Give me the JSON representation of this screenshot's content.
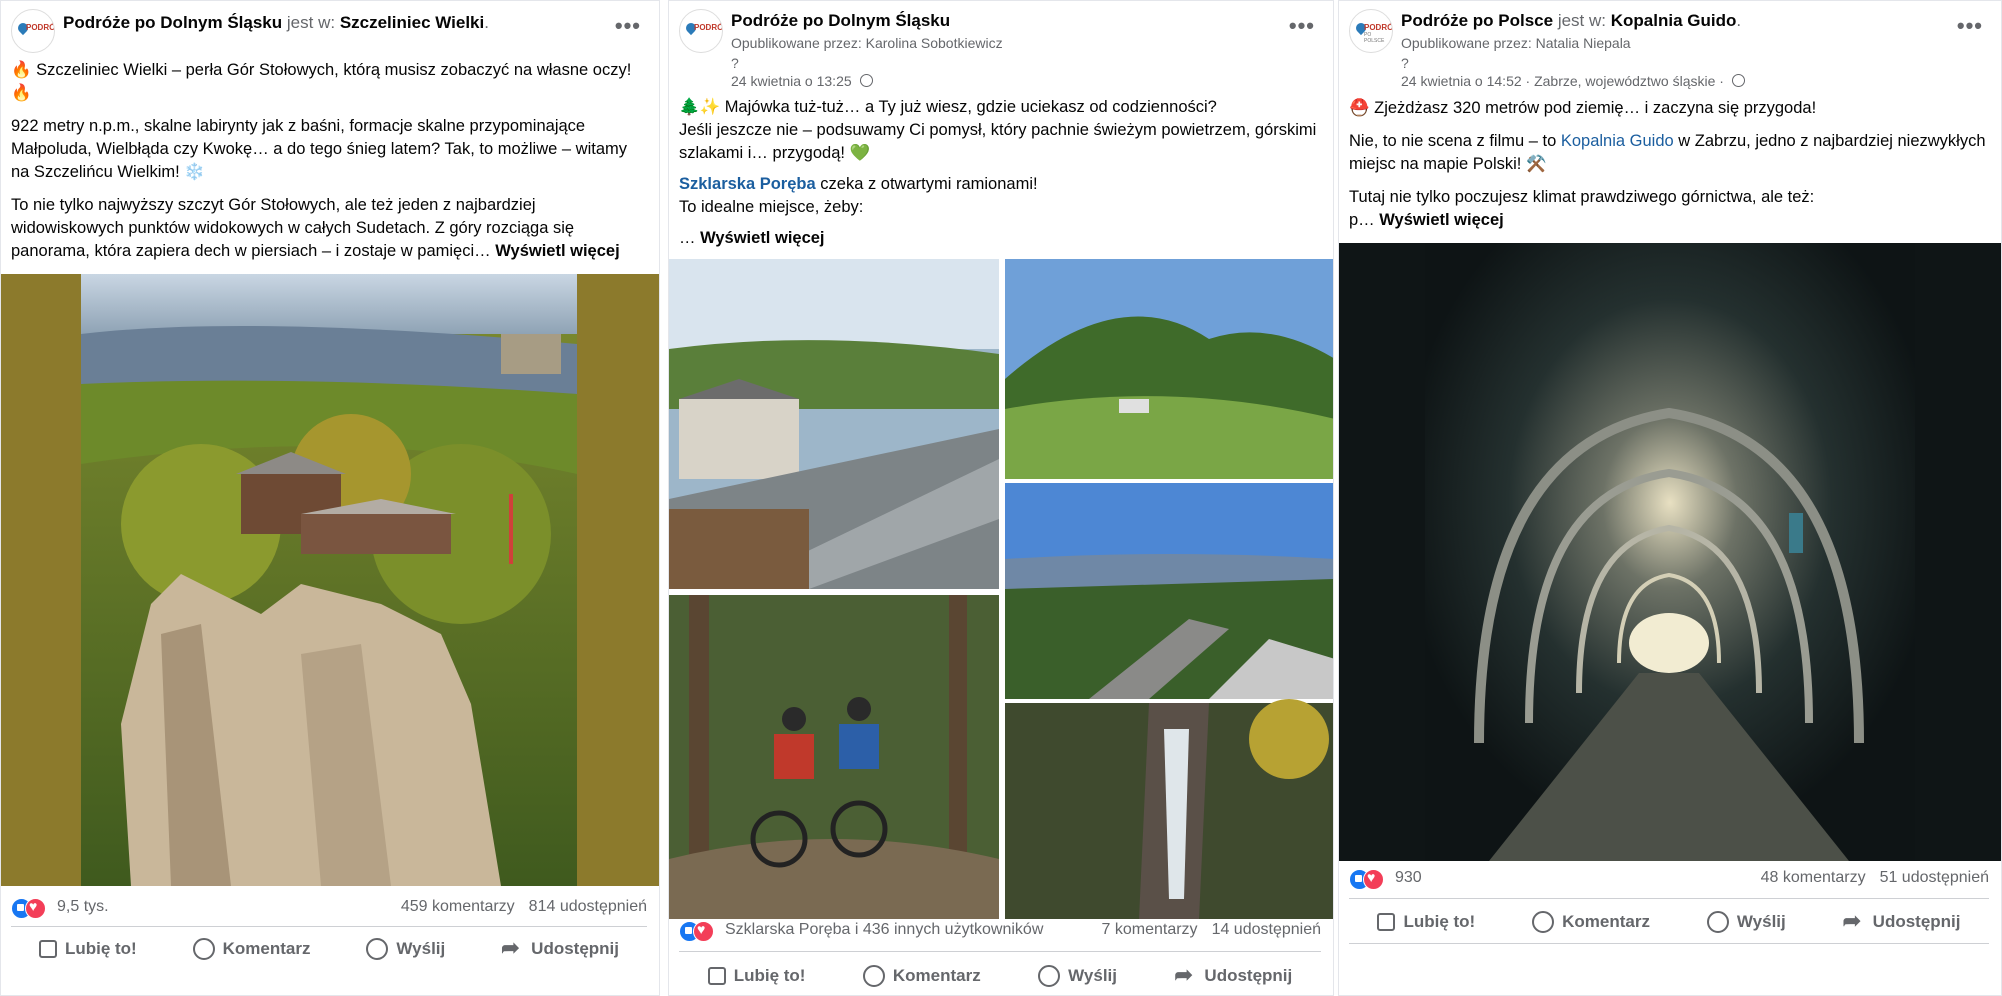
{
  "posts": [
    {
      "page": "Podróże po Dolnym Śląsku",
      "is_at_word": "jest w:",
      "place": "Szczeliniec Wielki",
      "place_dot": ".",
      "paragraphs": [
        "Szczeliniec Wielki – perła Gór Stołowych, którą musisz zobaczyć na własne oczy!",
        "922 metry n.p.m., skalne labirynty jak z baśni, formacje skalne przypominające Małpoluda, Wielbłąda czy Kwokę… a do tego śnieg latem? Tak, to możliwe – witamy na Szczelińcu Wielkim!",
        "To nie tylko najwyższy szczyt Gór Stołowych, ale też jeden z najbardziej widowiskowych punktów widokowych w całych Sudetach. Z góry rozciąga się panorama, która zapiera dech w piersiach – i zostaje w pamięci…"
      ],
      "see_more": "Wyświetl więcej",
      "reactions_count": "9,5 tys.",
      "comments": "459 komentarzy",
      "shares": "814 udostępnień",
      "actions": [
        "Lubię to!",
        "Komentarz",
        "Wyślij",
        "Udostępnij"
      ]
    },
    {
      "page": "Podróże po Dolnym Śląsku",
      "published_by_label": "Opublikowane przez:",
      "published_by": "Karolina Sobotkiewicz",
      "date": "24 kwietnia o 13:25",
      "line1": "Majówka tuż-tuż… a Ty już wiesz, gdzie uciekasz od codzienności?",
      "line2": "Jeśli jeszcze nie – podsuwamy Ci pomysł, który pachnie świeżym powietrzem, górskimi szlakami i… przygodą!",
      "place_link": "Szklarska Poręba",
      "place_rest": "czeka z otwartymi ramionami!",
      "line4": "To idealne miejsce, żeby:",
      "dots": "…",
      "see_more": "Wyświetl więcej",
      "reactions_text": "Szklarska Poręba i 436 innych użytkowników",
      "comments": "7 komentarzy",
      "shares": "14 udostępnień",
      "actions": [
        "Lubię to!",
        "Komentarz",
        "Wyślij",
        "Udostępnij"
      ]
    },
    {
      "page": "Podróże po Polsce",
      "is_at_word": "jest w:",
      "place": "Kopalnia Guido",
      "place_dot": ".",
      "published_by_label": "Opublikowane przez:",
      "published_by": "Natalia Niepala",
      "date": "24 kwietnia o 14:52 · Zabrze, województwo śląskie ·",
      "line1": "Zjeżdżasz 320 metrów pod ziemię… i zaczyna się przygoda!",
      "line2_a": "Nie, to nie scena z filmu – to",
      "line2_link": "Kopalnia Guido",
      "line2_b": "w Zabrzu, jedno z najbardziej niezwykłych miejsc na mapie Polski!",
      "line3": "Tutaj nie tylko poczujesz klimat prawdziwego górnictwa, ale też:",
      "line4": "p…",
      "see_more": "Wyświetl więcej",
      "reactions_count": "930",
      "comments": "48 komentarzy",
      "shares": "51 udostępnień",
      "actions": [
        "Lubię to!",
        "Komentarz",
        "Wyślij",
        "Udostępnij"
      ]
    }
  ],
  "colors": {
    "like": "#1877f2",
    "love": "#f33e58",
    "link": "#1b5e9f",
    "muted": "#65676b"
  },
  "icons": [
    "fire-icon",
    "snowflake-icon",
    "tree-icon",
    "sparkles-icon",
    "green-heart-icon",
    "helmet-icon",
    "pick-icon",
    "globe-icon",
    "more-icon",
    "like-icon",
    "comment-icon",
    "send-icon",
    "share-icon"
  ]
}
